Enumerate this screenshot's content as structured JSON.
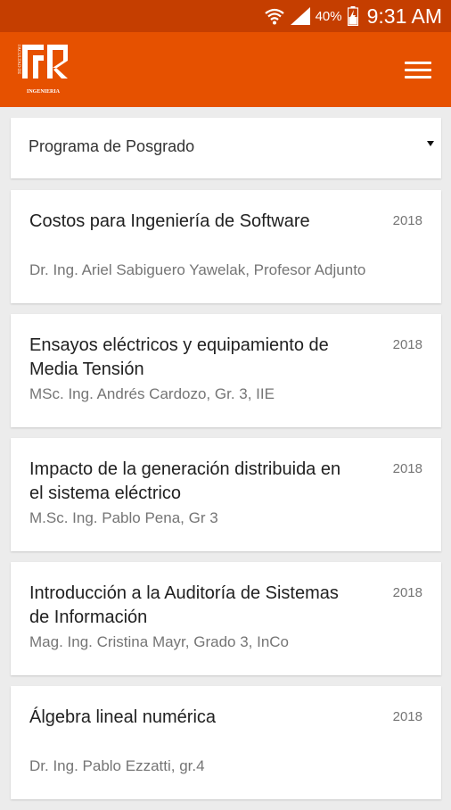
{
  "status_bar": {
    "battery_percent": "40%",
    "time": "9:31 AM"
  },
  "app_bar": {
    "logo_text": "FACULTAD DE INGENIERIA",
    "logo_icon": "faculty-logo",
    "menu_icon": "hamburger-menu-icon"
  },
  "filter": {
    "selected": "Programa de Posgrado",
    "icon": "dropdown-caret-icon"
  },
  "courses": [
    {
      "title": "Costos para Ingeniería de Software",
      "year": "2018",
      "author": "Dr. Ing. Ariel Sabiguero Yawelak, Profesor Adjunto"
    },
    {
      "title": "Ensayos eléctricos y equipamiento de Media Tensión",
      "year": "2018",
      "author": "MSc. Ing. Andrés Cardozo, Gr. 3, IIE"
    },
    {
      "title": "Impacto de la generación distribuida en el sistema eléctrico",
      "year": "2018",
      "author": "M.Sc. Ing. Pablo Pena, Gr 3"
    },
    {
      "title": "Introducción a la Auditoría de Sistemas de Información",
      "year": "2018",
      "author": "Mag. Ing. Cristina Mayr, Grado 3, InCo"
    },
    {
      "title": "Álgebra lineal numérica",
      "year": "2018",
      "author": "Dr. Ing. Pablo Ezzatti, gr.4"
    }
  ],
  "colors": {
    "status_bar": "#c53e00",
    "app_bar": "#e65100",
    "background": "#ececec"
  }
}
